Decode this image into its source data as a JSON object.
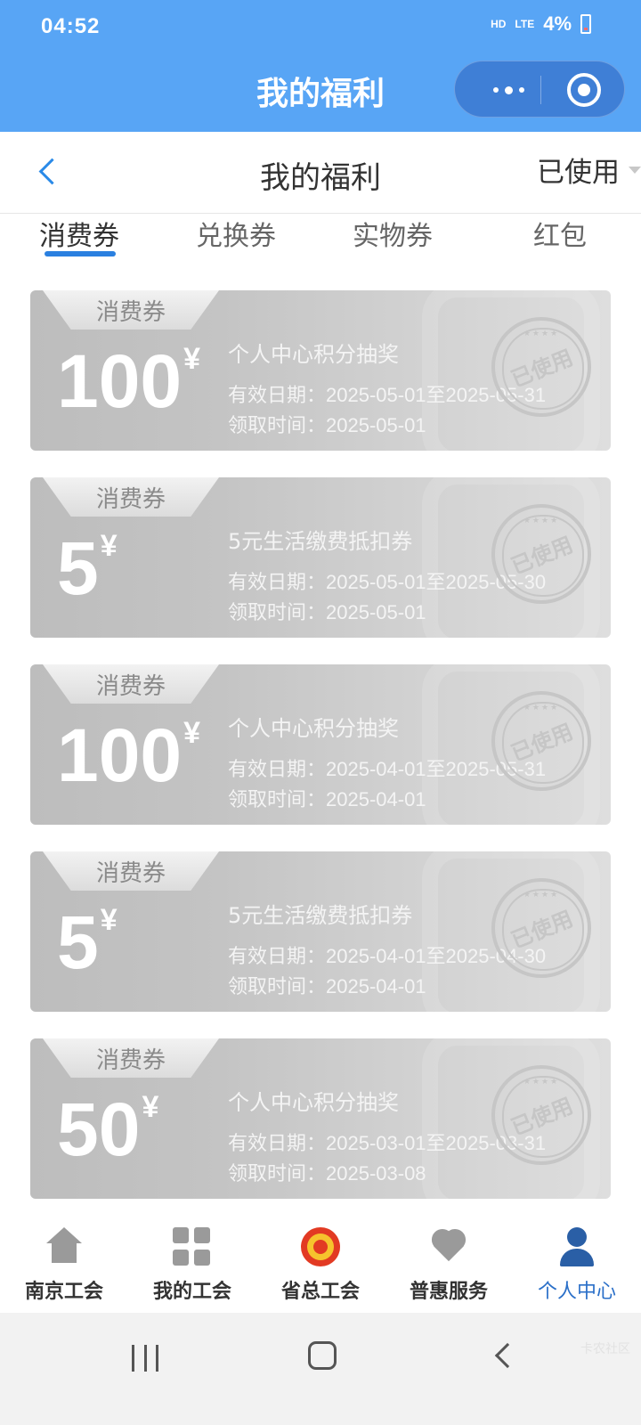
{
  "status_bar": {
    "time": "04:52",
    "hd": "HD",
    "lte": "LTE",
    "battery": "4%"
  },
  "miniprogram": {
    "title": "我的福利"
  },
  "header": {
    "title": "我的福利",
    "filter_label": "已使用"
  },
  "tabs": [
    {
      "label": "消费券",
      "active": true
    },
    {
      "label": "兑换券",
      "active": false
    },
    {
      "label": "实物券",
      "active": false
    },
    {
      "label": "红包",
      "active": false
    }
  ],
  "coupons": [
    {
      "tag": "消费券",
      "amount": "100",
      "currency": "¥",
      "name": "个人中心积分抽奖",
      "valid": "有效日期：2025-05-01至2025-05-31",
      "received": "领取时间：2025-05-01",
      "stamp": "已使用"
    },
    {
      "tag": "消费券",
      "amount": "5",
      "currency": "¥",
      "name": "5元生活缴费抵扣券",
      "valid": "有效日期：2025-05-01至2025-05-30",
      "received": "领取时间：2025-05-01",
      "stamp": "已使用"
    },
    {
      "tag": "消费券",
      "amount": "100",
      "currency": "¥",
      "name": "个人中心积分抽奖",
      "valid": "有效日期：2025-04-01至2025-05-31",
      "received": "领取时间：2025-04-01",
      "stamp": "已使用"
    },
    {
      "tag": "消费券",
      "amount": "5",
      "currency": "¥",
      "name": "5元生活缴费抵扣券",
      "valid": "有效日期：2025-04-01至2025-04-30",
      "received": "领取时间：2025-04-01",
      "stamp": "已使用"
    },
    {
      "tag": "消费券",
      "amount": "50",
      "currency": "¥",
      "name": "个人中心积分抽奖",
      "valid": "有效日期：2025-03-01至2025-03-31",
      "received": "领取时间：2025-03-08",
      "stamp": "已使用"
    }
  ],
  "bottom_nav": [
    {
      "label": "南京工会",
      "icon": "home-icon",
      "active": false
    },
    {
      "label": "我的工会",
      "icon": "grid-icon",
      "active": false
    },
    {
      "label": "省总工会",
      "icon": "union-emblem-icon",
      "active": false
    },
    {
      "label": "普惠服务",
      "icon": "heart-icon",
      "active": false
    },
    {
      "label": "个人中心",
      "icon": "person-icon",
      "active": true
    }
  ],
  "colors": {
    "header_blue": "#58a5f5",
    "accent_blue": "#2a80e0",
    "coupon_gray": "#c3c3c3",
    "active_nav": "#2a6fc8"
  },
  "watermark": "卡农社区"
}
